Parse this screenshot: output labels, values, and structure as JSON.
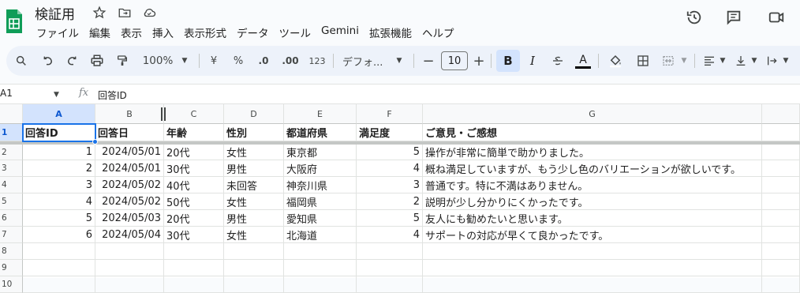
{
  "doc": {
    "title": "検証用"
  },
  "menu": [
    "ファイル",
    "編集",
    "表示",
    "挿入",
    "表示形式",
    "データ",
    "ツール",
    "Gemini",
    "拡張機能",
    "ヘルプ"
  ],
  "toolbar": {
    "zoom": "100%",
    "currency": "¥",
    "percent": "%",
    "dec_decrease": ".0",
    "dec_increase": ".00",
    "number_format": "123",
    "font": "デフォ...",
    "font_size": "10",
    "bold": "B",
    "italic": "I",
    "text_color": "A"
  },
  "formula": {
    "cell_ref": "A1",
    "fx": "fx",
    "value": "回答ID"
  },
  "columns": [
    "A",
    "B",
    "C",
    "D",
    "E",
    "F",
    "G"
  ],
  "rows": [
    "1",
    "2",
    "3",
    "4",
    "5",
    "6",
    "7",
    "8",
    "9",
    "10"
  ],
  "table": {
    "headers": [
      "回答ID",
      "回答日",
      "年齢",
      "性別",
      "都道府県",
      "満足度",
      "ご意見・ご感想"
    ],
    "data": [
      [
        "1",
        "2024/05/01",
        "20代",
        "女性",
        "東京都",
        "5",
        "操作が非常に簡単で助かりました。"
      ],
      [
        "2",
        "2024/05/01",
        "30代",
        "男性",
        "大阪府",
        "4",
        "概ね満足していますが、もう少し色のバリエーションが欲しいです。"
      ],
      [
        "3",
        "2024/05/02",
        "40代",
        "未回答",
        "神奈川県",
        "3",
        "普通です。特に不満はありません。"
      ],
      [
        "4",
        "2024/05/02",
        "50代",
        "女性",
        "福岡県",
        "2",
        "説明が少し分かりにくかったです。"
      ],
      [
        "5",
        "2024/05/03",
        "20代",
        "男性",
        "愛知県",
        "5",
        "友人にも勧めたいと思います。"
      ],
      [
        "6",
        "2024/05/04",
        "30代",
        "女性",
        "北海道",
        "4",
        "サポートの対応が早くて良かったです。"
      ]
    ]
  },
  "colors": {
    "accent": "#1a73e8",
    "selected_header": "#d3e3fd",
    "toolbar_bg": "#edf2fa",
    "logo": "#0f9d58"
  }
}
